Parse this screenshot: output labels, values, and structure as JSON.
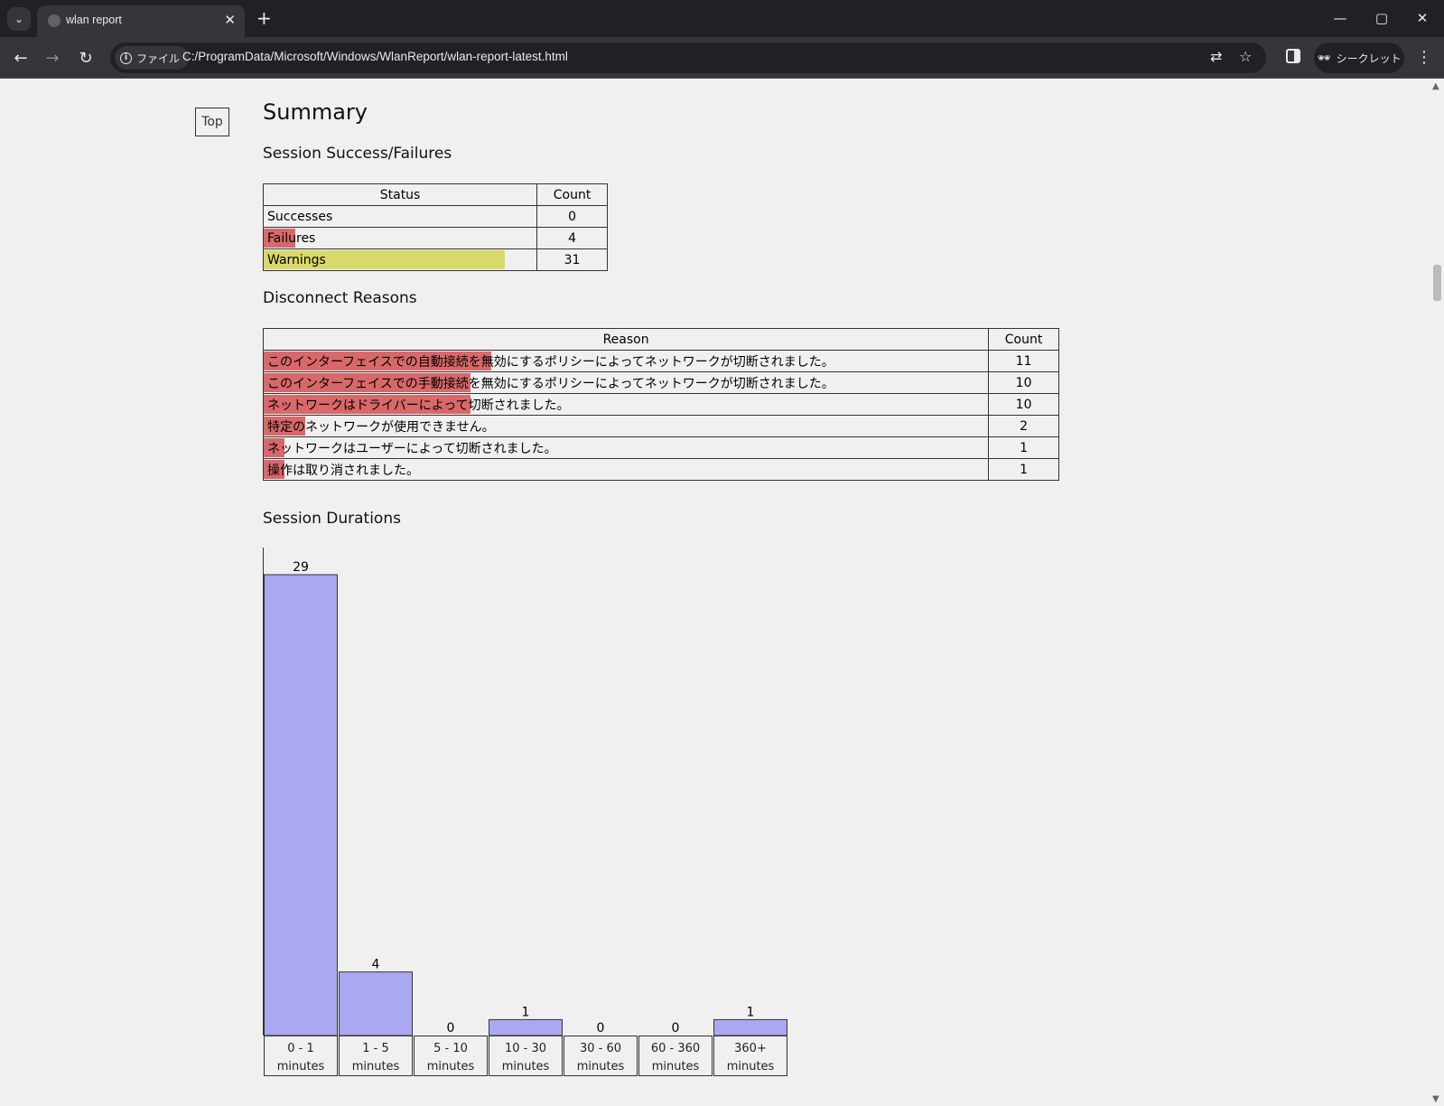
{
  "browser": {
    "tab_title": "wlan report",
    "new_tab": "+",
    "chip_label": "ファイル",
    "url": "C:/ProgramData/Microsoft/Windows/WlanReport/wlan-report-latest.html",
    "incognito_label": "シークレット"
  },
  "page": {
    "top_link": "Top",
    "title": "Summary",
    "session_heading": "Session Success/Failures",
    "status_table": {
      "headers": [
        "Status",
        "Count"
      ],
      "rows": [
        {
          "label": "Successes",
          "count": "0",
          "bar_fraction": 0,
          "bar_color": "#d9686a"
        },
        {
          "label": "Failures",
          "count": "4",
          "bar_fraction": 0.115,
          "bar_color": "#d9686a"
        },
        {
          "label": "Warnings",
          "count": "31",
          "bar_fraction": 0.885,
          "bar_color": "#d9d96a"
        }
      ]
    },
    "disconnect_heading": "Disconnect Reasons",
    "reason_table": {
      "headers": [
        "Reason",
        "Count"
      ],
      "rows": [
        {
          "label": "このインターフェイスでの自動接続を無効にするポリシーによってネットワークが切断されました。",
          "count": "11",
          "bar_fraction": 0.314
        },
        {
          "label": "このインターフェイスでの手動接続を無効にするポリシーによってネットワークが切断されました。",
          "count": "10",
          "bar_fraction": 0.286
        },
        {
          "label": "ネットワークはドライバーによって切断されました。",
          "count": "10",
          "bar_fraction": 0.286
        },
        {
          "label": "特定のネットワークが使用できません。",
          "count": "2",
          "bar_fraction": 0.057
        },
        {
          "label": "ネットワークはユーザーによって切断されました。",
          "count": "1",
          "bar_fraction": 0.029
        },
        {
          "label": "操作は取り消されました。",
          "count": "1",
          "bar_fraction": 0.029
        }
      ]
    },
    "durations_heading": "Session Durations"
  },
  "chart_data": {
    "type": "bar",
    "categories": [
      "0 - 1 minutes",
      "1 - 5 minutes",
      "5 - 10 minutes",
      "10 - 30 minutes",
      "30 - 60 minutes",
      "60 - 360 minutes",
      "360+ minutes"
    ],
    "category_lines": [
      [
        "0 - 1",
        "minutes"
      ],
      [
        "1 - 5",
        "minutes"
      ],
      [
        "5 - 10",
        "minutes"
      ],
      [
        "10 - 30",
        "minutes"
      ],
      [
        "30 - 60",
        "minutes"
      ],
      [
        "60 - 360",
        "minutes"
      ],
      [
        "360+",
        "minutes"
      ]
    ],
    "values": [
      29,
      4,
      0,
      1,
      0,
      0,
      1
    ],
    "title": "Session Durations",
    "bar_color": "#aaa8f0",
    "ylim": [
      0,
      29
    ]
  }
}
